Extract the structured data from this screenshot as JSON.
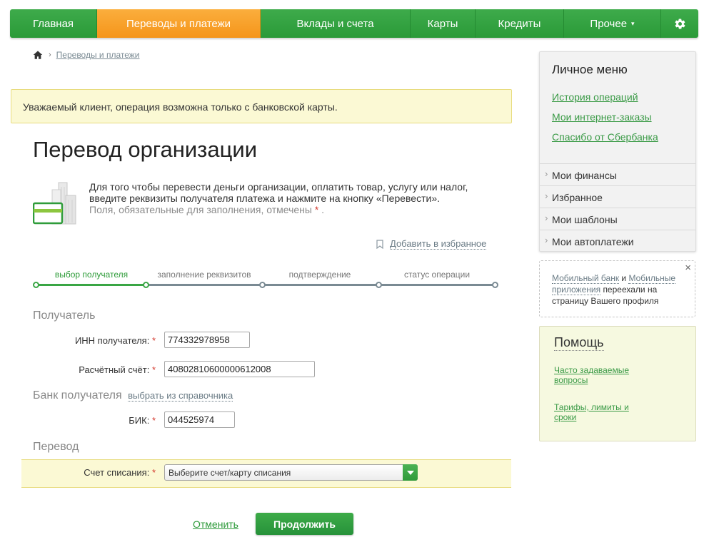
{
  "nav": {
    "items": [
      {
        "label": "Главная"
      },
      {
        "label": "Переводы и платежи"
      },
      {
        "label": "Вклады и счета"
      },
      {
        "label": "Карты"
      },
      {
        "label": "Кредиты"
      },
      {
        "label": "Прочее"
      }
    ],
    "active_color": "#f7a027",
    "brand_color": "#309f3d"
  },
  "breadcrumb": {
    "current": "Переводы и платежи"
  },
  "notice": "Уважаемый клиент, операция возможна только с банковской карты.",
  "page_title": "Перевод организации",
  "intro": {
    "text": "Для того чтобы перевести деньги организации, оплатить товар, услугу или налог, введите реквизиты получателя платежа и нажмите на кнопку «Перевести».",
    "note": "Поля, обязательные для заполнения, отмечены",
    "note_end": "."
  },
  "favorites_link": "Добавить в избранное",
  "steps": [
    {
      "label": "выбор получателя",
      "active": true
    },
    {
      "label": "заполнение реквизитов",
      "active": false
    },
    {
      "label": "подтверждение",
      "active": false
    },
    {
      "label": "статус операции",
      "active": false
    }
  ],
  "recipient": {
    "section": "Получатель",
    "inn_label": "ИНН получателя:",
    "inn_value": "774332978958",
    "account_label": "Расчётный счёт:",
    "account_value": "40802810600000612008"
  },
  "bank": {
    "section": "Банк получателя",
    "dictionary_link": "выбрать из справочника",
    "bik_label": "БИК:",
    "bik_value": "044525974"
  },
  "transfer": {
    "section": "Перевод",
    "debit_label": "Счет списания:",
    "debit_placeholder": "Выберите счет/карту списания"
  },
  "actions": {
    "cancel": "Отменить",
    "continue": "Продолжить"
  },
  "required_mark": "*",
  "personal_menu": {
    "title": "Личное меню",
    "links": [
      "История операций",
      "Мои интернет-заказы",
      "Спасибо от Сбербанка"
    ],
    "groups": [
      "Мои финансы",
      "Избранное",
      "Мои шаблоны",
      "Мои автоплатежи"
    ]
  },
  "mobile_notice": {
    "link1": "Мобильный банк",
    "and": "и",
    "link2": "Мобильные приложения",
    "text": "переехали на страницу Вашего профиля",
    "close": "×"
  },
  "help": {
    "title": "Помощь",
    "links": [
      "Часто задаваемые вопросы",
      "Тарифы, лимиты и сроки"
    ]
  },
  "icons": {
    "home": "home-icon",
    "gear": "gear-icon",
    "bookmark": "bookmark-icon",
    "dropdown": "chevron-down-icon"
  }
}
